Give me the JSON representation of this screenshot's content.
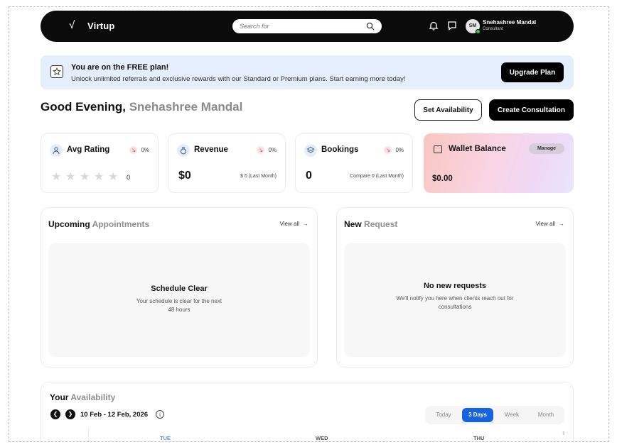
{
  "header": {
    "brand": "Virtup",
    "search_placeholder": "Search for",
    "user": {
      "name": "Snehashree Mandal",
      "role": "Consultant",
      "initials": "SM"
    }
  },
  "banner": {
    "title": "You are on the FREE plan!",
    "subtitle": "Unlock unlimited referrals and exclusive rewards with our Standard or Premium plans. Start earning more today!",
    "button": "Upgrade Plan"
  },
  "greeting": {
    "prefix": "Good Evening,",
    "name": "Snehashree Mandal"
  },
  "actions": {
    "set_availability": "Set Availability",
    "create_consultation": "Create Consultation"
  },
  "stats": {
    "rating": {
      "title": "Avg Rating",
      "change": "0%",
      "count": "0"
    },
    "revenue": {
      "title": "Revenue",
      "change": "0%",
      "value": "$0",
      "compare": "$ 0 (Last Month)"
    },
    "bookings": {
      "title": "Bookings",
      "change": "0%",
      "value": "0",
      "compare": "Compare 0 (Last Month)"
    },
    "wallet": {
      "title": "Wallet Balance",
      "button": "Manage",
      "value": "$0.00"
    }
  },
  "upcoming": {
    "title_bold": "Upcoming",
    "title_muted": "Appointments",
    "view_all": "View all",
    "empty_title": "Schedule Clear",
    "empty_sub": "Your schedule is clear for the next 48 hours"
  },
  "requests": {
    "title_bold": "New",
    "title_muted": "Request",
    "view_all": "View all",
    "empty_title": "No new requests",
    "empty_sub": "We'll notify you here when clients reach out for consultations"
  },
  "availability": {
    "title_bold": "Your",
    "title_muted": "Availability",
    "date_range": "10 Feb - 12 Feb, 2026",
    "views": [
      "Today",
      "3 Days",
      "Week",
      "Month"
    ],
    "active_view": "3 Days",
    "days": [
      "TUE",
      "WED",
      "THU"
    ]
  },
  "colors": {
    "accent": "#1463e0",
    "dark": "#0b0b0b",
    "banner_bg": "#e4eefc",
    "negative": "#e0565b"
  }
}
